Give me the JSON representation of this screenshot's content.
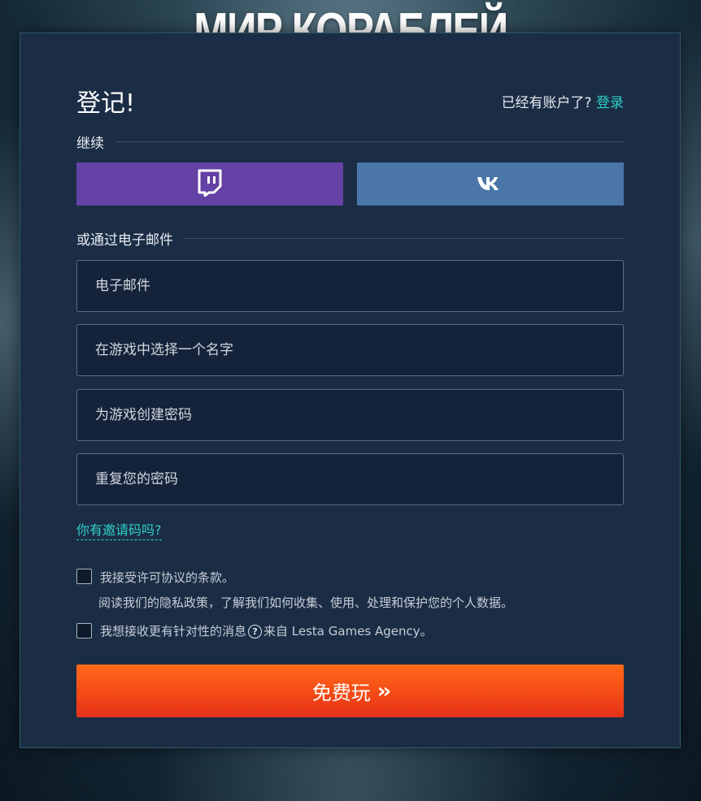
{
  "brand": {
    "logo_text": "МИР КОРАБЛЕЙ"
  },
  "header": {
    "title": "登记!",
    "have_account_text": "已经有账户了?",
    "login_link": "登录"
  },
  "social": {
    "continue_label": "继续",
    "buttons": [
      {
        "name": "twitch",
        "icon": "twitch-icon",
        "color": "#6441a4"
      },
      {
        "name": "vk",
        "icon": "vk-icon",
        "color": "#4a76a8"
      }
    ]
  },
  "email_section": {
    "label": "或通过电子邮件",
    "fields": {
      "email": {
        "placeholder": "电子邮件",
        "value": ""
      },
      "username": {
        "placeholder": "在游戏中选择一个名字",
        "value": ""
      },
      "password": {
        "placeholder": "为游戏创建密码",
        "value": ""
      },
      "password_repeat": {
        "placeholder": "重复您的密码",
        "value": ""
      }
    },
    "invite_link": "你有邀请码吗?"
  },
  "agreements": {
    "license_text": "我接受许可协议的条款。",
    "privacy_text": "阅读我们的隐私政策，了解我们如何收集、使用、处理和保护您的个人数据。",
    "marketing_text_before": "我想接收更有针对性的消息",
    "marketing_text_after": "来自 Lesta Games Agency。"
  },
  "submit": {
    "label": "免费玩",
    "accent_color": "#f44a16"
  },
  "colors": {
    "panel": "#1b2d45",
    "link": "#2fd1c8"
  }
}
